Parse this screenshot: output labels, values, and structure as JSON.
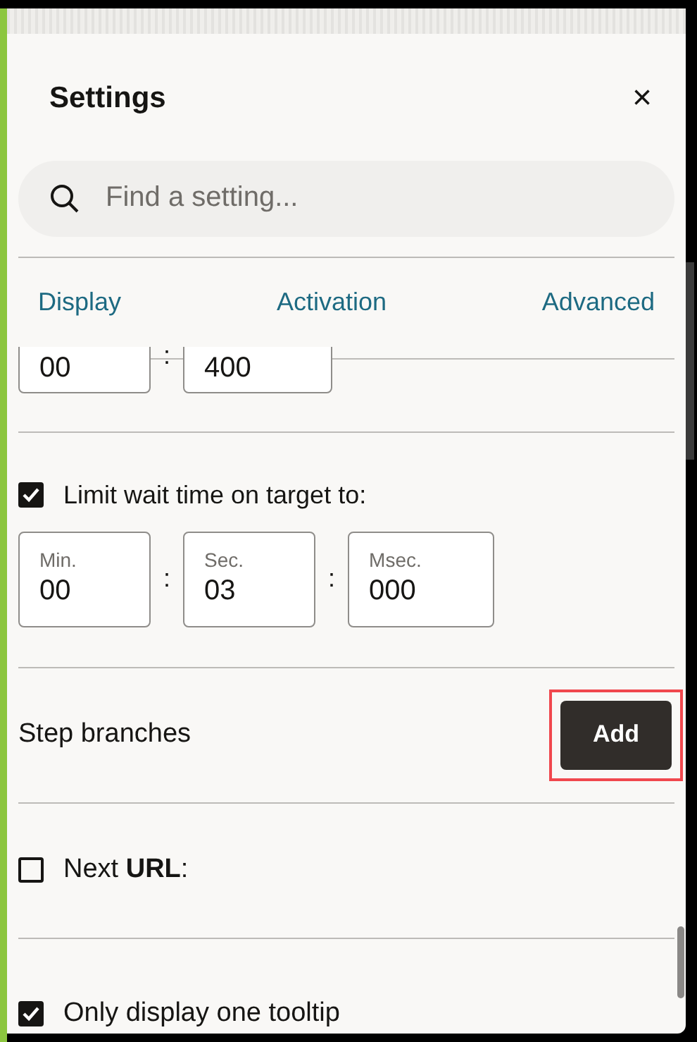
{
  "panel": {
    "title": "Settings",
    "close": "×"
  },
  "search": {
    "placeholder": "Find a setting..."
  },
  "tabs": [
    {
      "label": "Display"
    },
    {
      "label": "Activation"
    },
    {
      "label": "Advanced"
    }
  ],
  "partial_fields": {
    "values": [
      "00",
      "400"
    ],
    "separator": ":"
  },
  "wait_limit": {
    "label": "Limit wait time on target to:",
    "checked": true,
    "fields": [
      {
        "label": "Min.",
        "value": "00"
      },
      {
        "label": "Sec.",
        "value": "03"
      },
      {
        "label": "Msec.",
        "value": "000"
      }
    ],
    "separator": ":"
  },
  "step_branches": {
    "label": "Step branches",
    "button": "Add",
    "highlighted": true
  },
  "next_url": {
    "label": "Next **URL**:",
    "checked": false
  },
  "one_tooltip": {
    "label": "Only display one tooltip",
    "checked": true
  }
}
